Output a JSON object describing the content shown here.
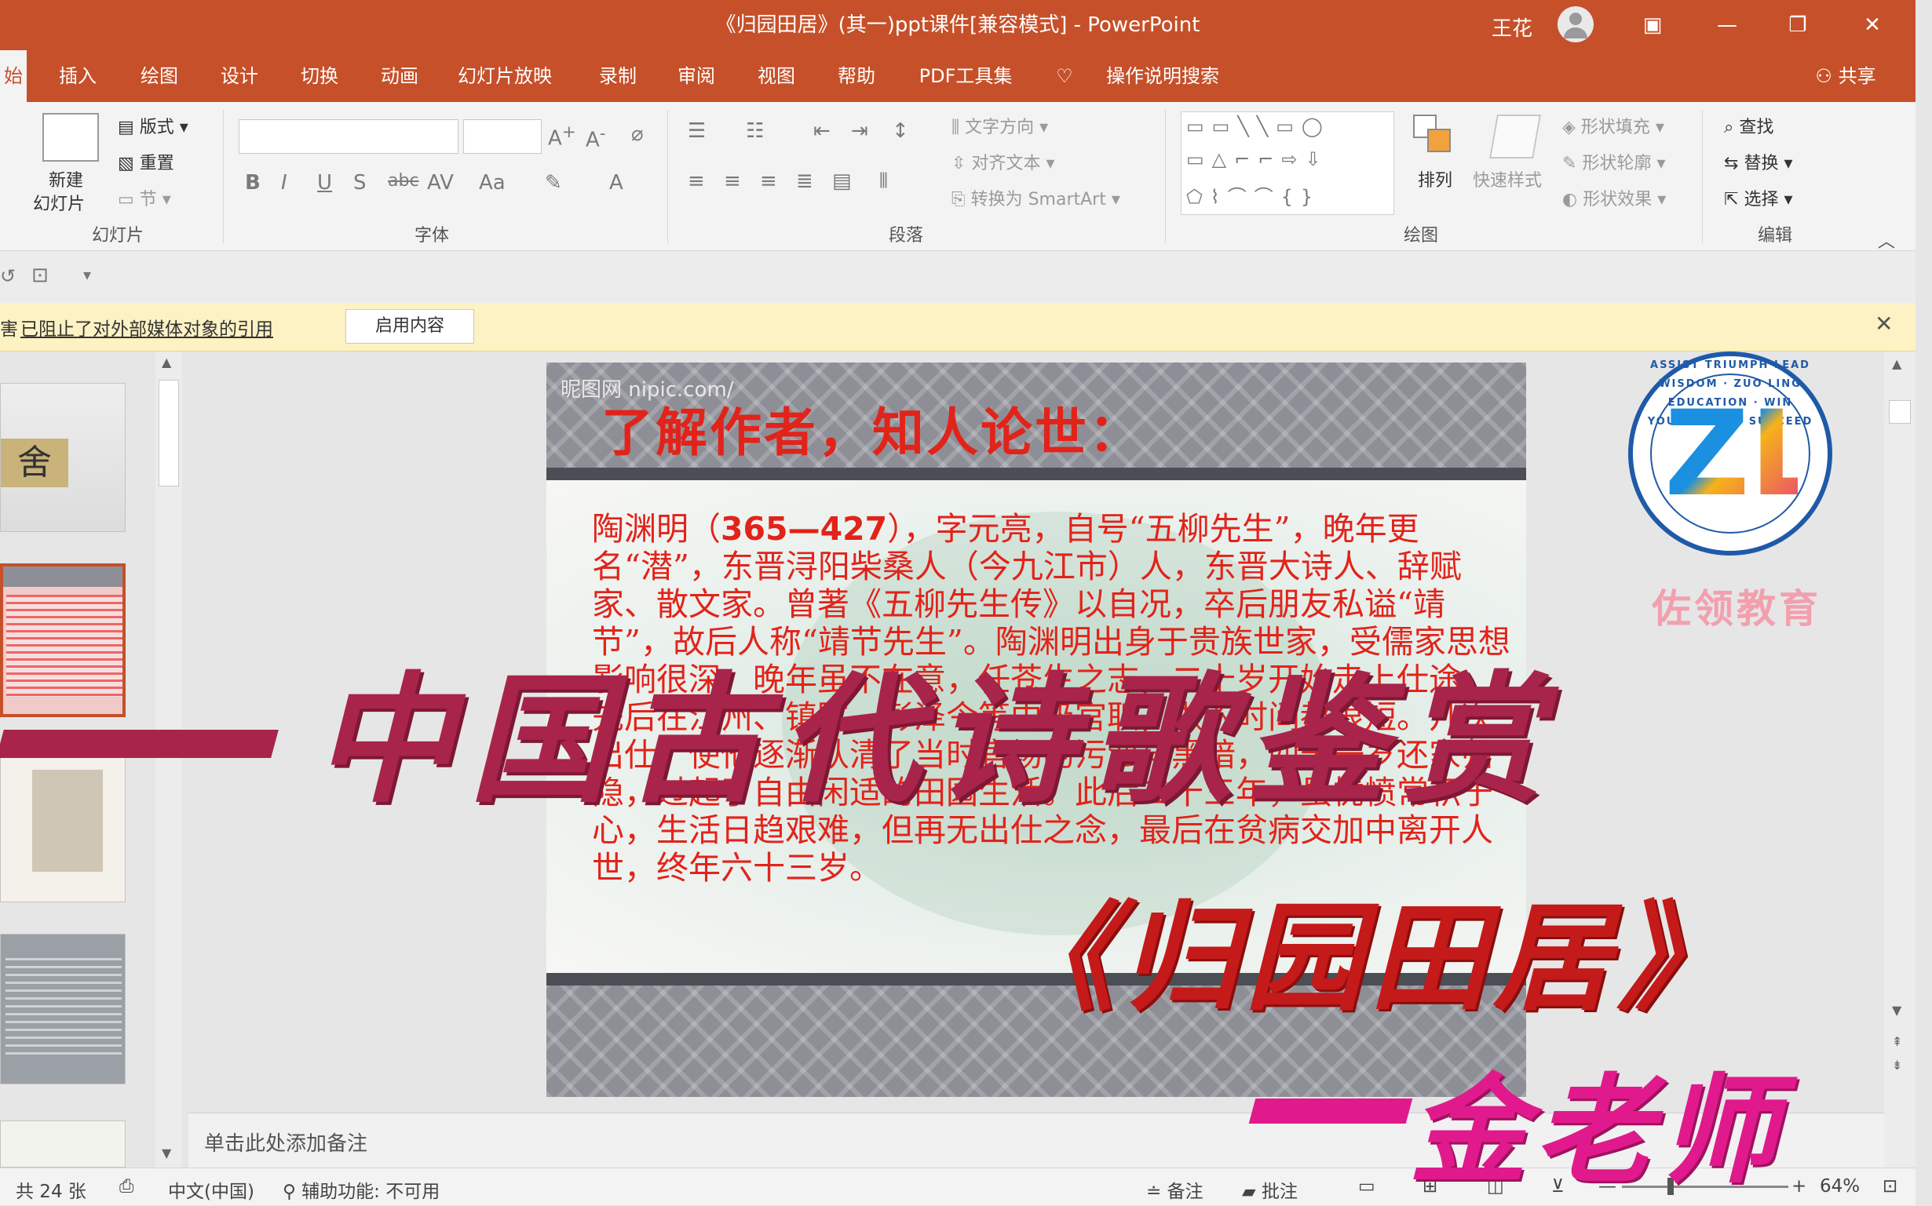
{
  "window": {
    "title": "《归园田居》(其一)ppt课件[兼容模式] - PowerPoint",
    "user": "王花",
    "share": "共享"
  },
  "tabs": [
    "始",
    "插入",
    "绘图",
    "设计",
    "切换",
    "动画",
    "幻灯片放映",
    "录制",
    "审阅",
    "视图",
    "帮助",
    "PDF工具集"
  ],
  "tell_me": "操作说明搜索",
  "ribbon": {
    "slides": {
      "new_slide": "新建",
      "new_slide2": "幻灯片",
      "layout": "版式",
      "reset": "重置",
      "section": "节",
      "label": "幻灯片"
    },
    "font": {
      "label": "字体"
    },
    "paragraph": {
      "text_direction": "文字方向",
      "align_text": "对齐文本",
      "smartart": "转换为 SmartArt",
      "label": "段落"
    },
    "drawing": {
      "arrange": "排列",
      "quick_styles": "快速样式",
      "shape_fill": "形状填充",
      "shape_outline": "形状轮廓",
      "shape_effects": "形状效果",
      "label": "绘图"
    },
    "editing": {
      "find": "查找",
      "replace": "替换",
      "select": "选择",
      "label": "编辑"
    }
  },
  "message_bar": {
    "text": "已阻止了对外部媒体对象的引用",
    "button": "启用内容"
  },
  "slide": {
    "watermark": "昵图网 nipic.com/",
    "title": "了解作者，知人论世：",
    "body_lead": "陶渊明（",
    "body_years": "365—427",
    "body_rest": "），字元亮，自号“五柳先生”，晚年更名“潜”，东晋浔阳柴桑人（今九江市）人，东晋大诗人、辞赋家、散文家。曾著《五柳先生传》以自况，卒后朋友私谥“靖节”，故后人称“靖节先生”。陶渊明出身于贵族世家，受儒家思想影响很深，晚年虽不在意，任苍生之志，二十岁开始走上仕途，先后在江州、镇军、彭泽令等中级官职，做的时间都很短。几次出仕，使他逐渐认清了当时官场的污浊与黑暗，四十一岁还家归隐，过起了自由闲适的田园生活。此后二十三年，虽忧愤常积于心，生活日趋艰难，但再无出仕之念，最后在贫病交加中离开人世，终年六十三岁。"
  },
  "notes": {
    "placeholder": "单击此处添加备注"
  },
  "status": {
    "slide_count": "共 24 张",
    "language": "中文(中国)",
    "accessibility": "辅助功能: 不可用",
    "notes": "备注",
    "comments": "批注",
    "zoom": "64%"
  },
  "overlay": {
    "subtitle": "中国古代诗歌鉴赏",
    "poem": "《归园田居》",
    "teacher": "金老师",
    "logo_ring": "ASSIST TRIUMPH LEAD WISDOM · ZUO LING EDUCATION · WIN YOURSELF TO SUCCEED",
    "logo_name": "佐领教育"
  },
  "colors": {
    "accent": "#c6502a",
    "slide_red": "#e2231a",
    "overlay_maroon": "#a8244a",
    "overlay_pink": "#e01a8c"
  }
}
